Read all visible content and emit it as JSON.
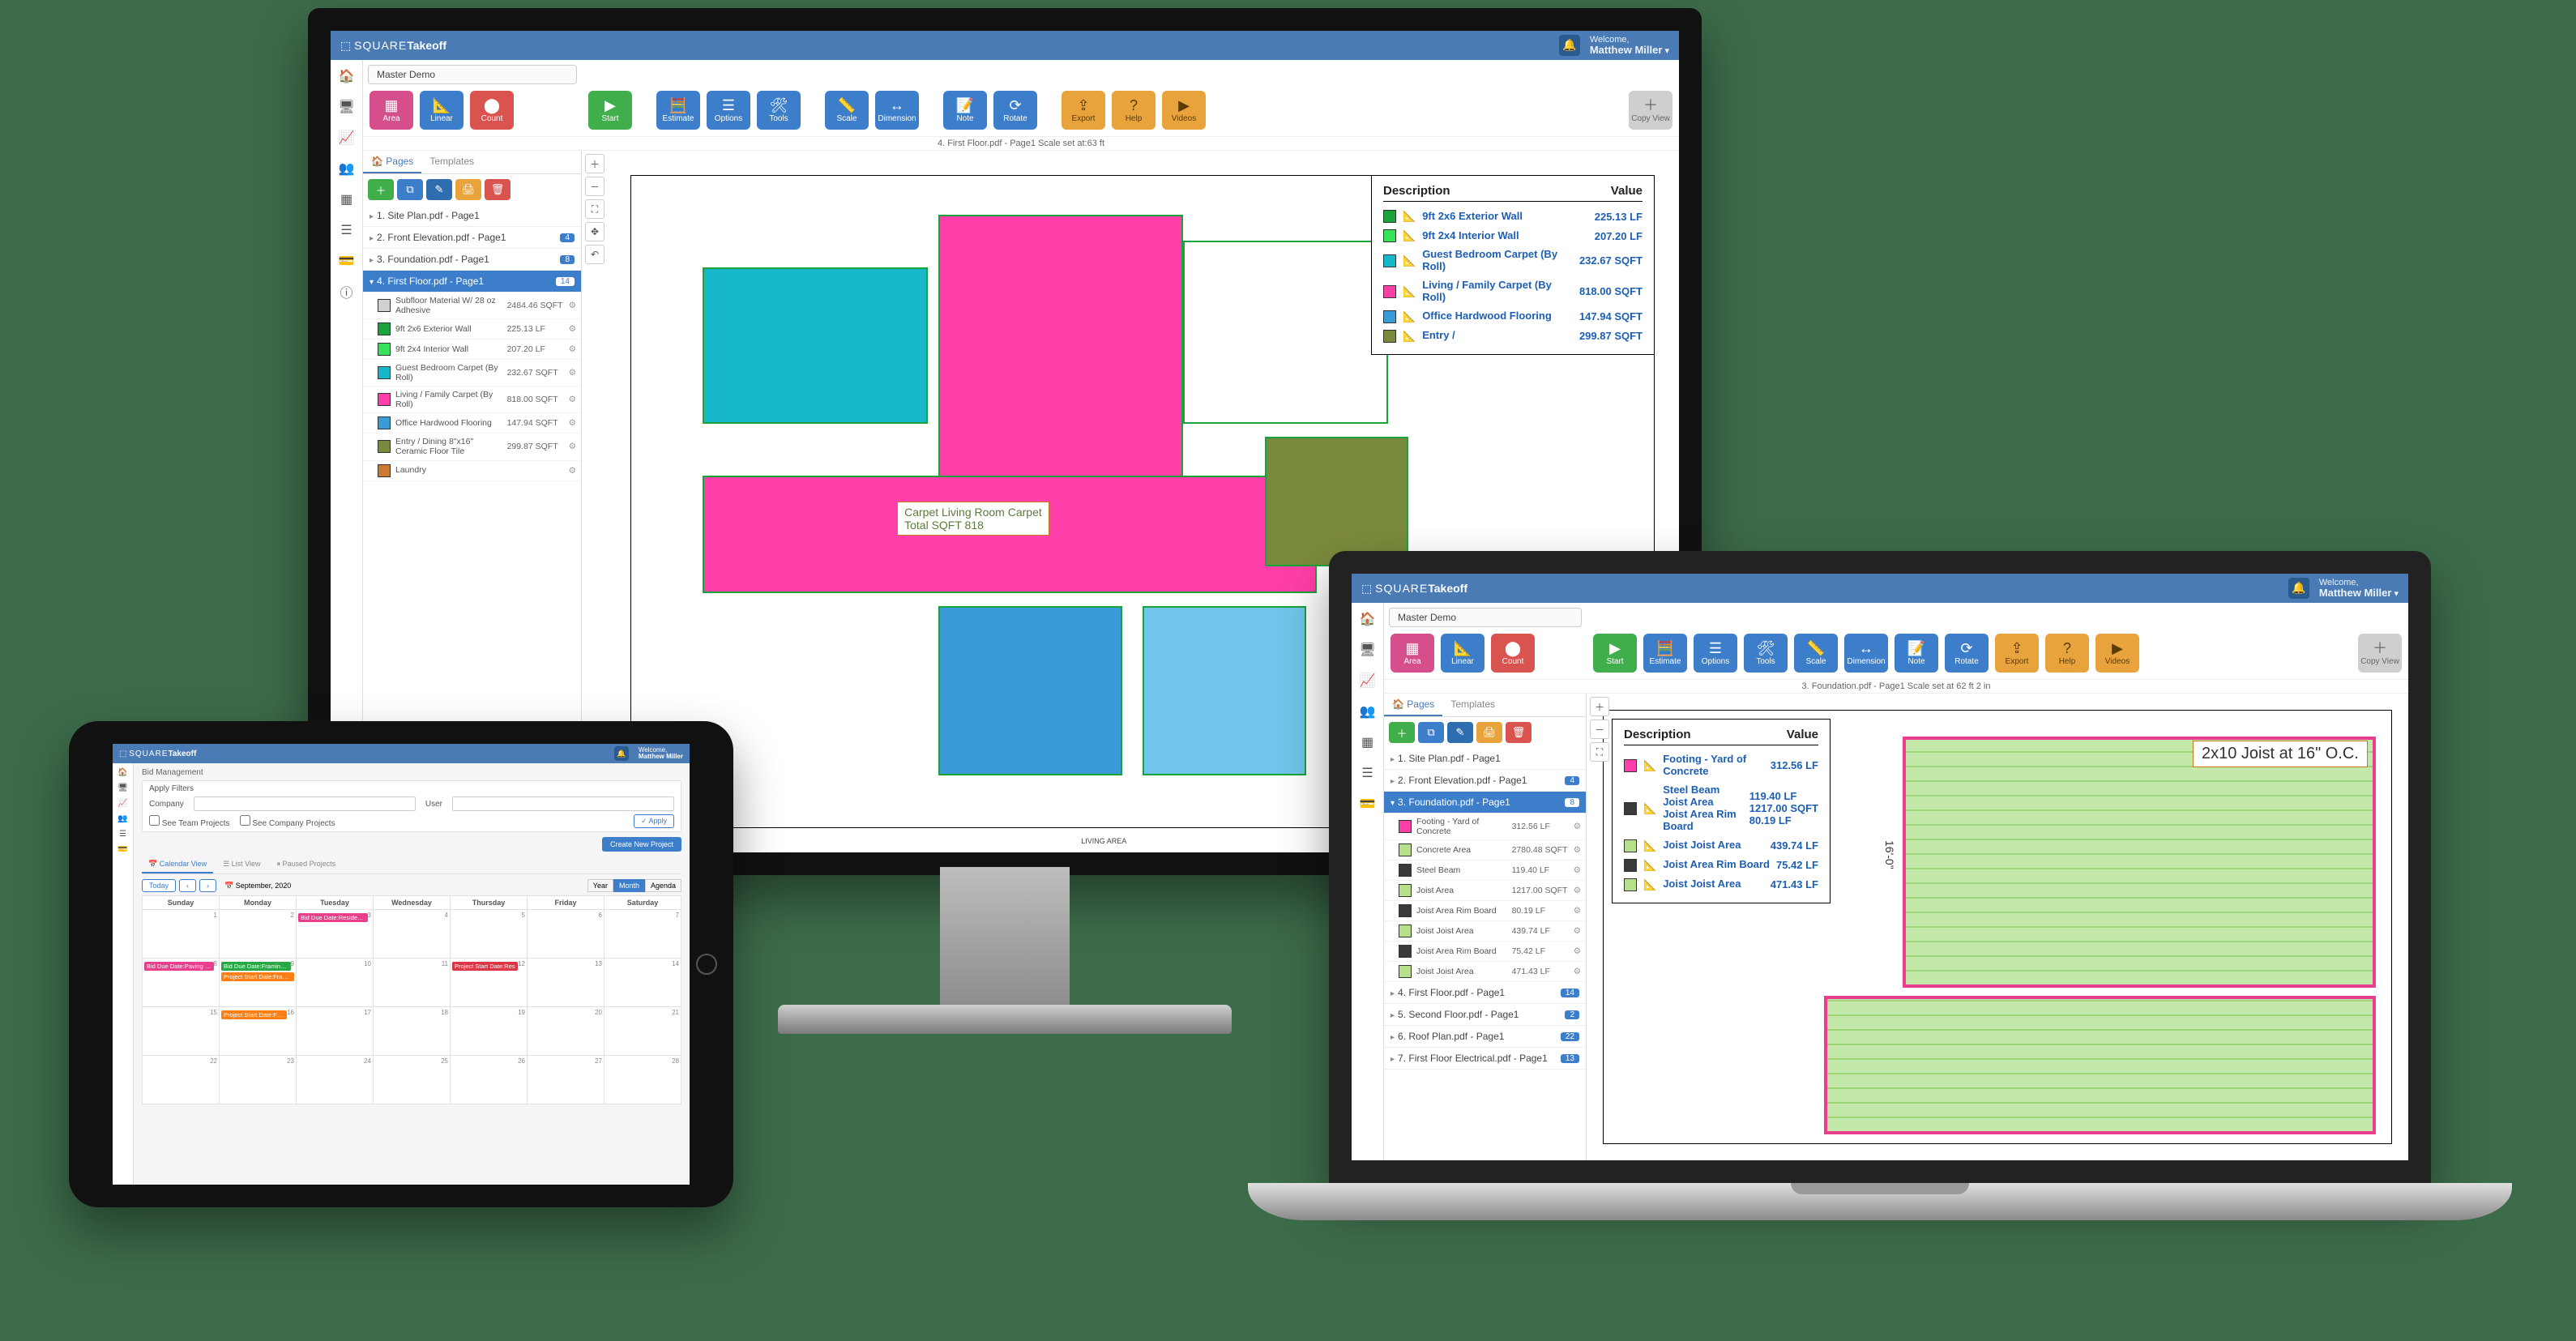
{
  "brand": {
    "part1": "SQUARE",
    "part2": "Takeoff"
  },
  "user": {
    "welcome": "Welcome,",
    "name": "Matthew Miller"
  },
  "ribbon": {
    "area": "Area",
    "linear": "Linear",
    "count": "Count",
    "start": "Start",
    "estimate": "Estimate",
    "options": "Options",
    "tools": "Tools",
    "scale": "Scale",
    "dimension": "Dimension",
    "note": "Note",
    "rotate": "Rotate",
    "export": "Export",
    "help": "Help",
    "videos": "Videos",
    "copy": "Copy View"
  },
  "monitor": {
    "project": "Master Demo",
    "breadcrumb": "4. First Floor.pdf - Page1 Scale set at:63 ft",
    "tabs": {
      "pages": "Pages",
      "templates": "Templates"
    },
    "pages": [
      {
        "name": "1. Site Plan.pdf - Page1"
      },
      {
        "name": "2. Front Elevation.pdf - Page1",
        "count": "4"
      },
      {
        "name": "3. Foundation.pdf - Page1",
        "count": "8"
      },
      {
        "name": "4. First Floor.pdf - Page1",
        "count": "14",
        "active": true
      }
    ],
    "measurements": [
      {
        "color": "#d1d1d1",
        "desc": "Subfloor Material W/ 28 oz Adhesive",
        "val": "2484.46 SQFT"
      },
      {
        "color": "#1aa33a",
        "desc": "9ft 2x6 Exterior Wall",
        "val": "225.13 LF"
      },
      {
        "color": "#34e35a",
        "desc": "9ft 2x4 Interior Wall",
        "val": "207.20 LF"
      },
      {
        "color": "#16b7c9",
        "desc": "Guest Bedroom Carpet (By Roll)",
        "val": "232.67 SQFT"
      },
      {
        "color": "#ff3fa9",
        "desc": "Living / Family Carpet (By Roll)",
        "val": "818.00 SQFT"
      },
      {
        "color": "#3a9bd8",
        "desc": "Office Hardwood Flooring",
        "val": "147.94 SQFT"
      },
      {
        "color": "#7a8a3d",
        "desc": "Entry / Dining 8\"x16\" Ceramic Floor Tile",
        "val": "299.87 SQFT"
      },
      {
        "color": "#cc7a33",
        "desc": "Laundry",
        "val": ""
      }
    ],
    "floor_label_line1": "Carpet Living Room Carpet",
    "floor_label_line2": "Total SQFT 818",
    "floor_living_area": "LIVING AREA",
    "legend": {
      "hdr_desc": "Description",
      "hdr_val": "Value",
      "rows": [
        {
          "color": "#1aa33a",
          "desc": "9ft 2x6 Exterior Wall",
          "val": "225.13 LF"
        },
        {
          "color": "#34e35a",
          "desc": "9ft 2x4 Interior Wall",
          "val": "207.20 LF"
        },
        {
          "color": "#16b7c9",
          "desc": "Guest Bedroom Carpet (By Roll)",
          "val": "232.67 SQFT"
        },
        {
          "color": "#ff3fa9",
          "desc": "Living / Family Carpet (By Roll)",
          "val": "818.00 SQFT"
        },
        {
          "color": "#3a9bd8",
          "desc": "Office Hardwood Flooring",
          "val": "147.94 SQFT"
        },
        {
          "color": "#7a8a3d",
          "desc": "Entry /",
          "val": "299.87 SQFT"
        }
      ]
    }
  },
  "laptop": {
    "project": "Master Demo",
    "breadcrumb": "3. Foundation.pdf - Page1 Scale set at 62 ft 2 in",
    "pages": [
      {
        "name": "1. Site Plan.pdf - Page1"
      },
      {
        "name": "2. Front Elevation.pdf - Page1",
        "count": "4"
      },
      {
        "name": "3. Foundation.pdf - Page1",
        "count": "8",
        "active": true
      },
      {
        "name": "4. First Floor.pdf - Page1",
        "count": "14"
      },
      {
        "name": "5. Second Floor.pdf - Page1",
        "count": "2"
      },
      {
        "name": "6. Roof Plan.pdf - Page1",
        "count": "22"
      },
      {
        "name": "7. First Floor Electrical.pdf - Page1",
        "count": "13"
      }
    ],
    "measurements": [
      {
        "color": "#ff3fa9",
        "desc": "Footing - Yard of Concrete",
        "val": "312.56 LF"
      },
      {
        "color": "#b7e08a",
        "desc": "Concrete Area",
        "val": "2780.48 SQFT"
      },
      {
        "color": "#3a3a3a",
        "desc": "Steel Beam",
        "val": "119.40 LF"
      },
      {
        "color": "#b7e08a",
        "desc": "Joist Area",
        "val": "1217.00 SQFT"
      },
      {
        "color": "#3a3a3a",
        "desc": "Joist Area Rim Board",
        "val": "80.19 LF"
      },
      {
        "color": "#b7e08a",
        "desc": "Joist Joist Area",
        "val": "439.74 LF"
      },
      {
        "color": "#3a3a3a",
        "desc": "Joist Area Rim Board",
        "val": "75.42 LF"
      },
      {
        "color": "#b7e08a",
        "desc": "Joist Joist Area",
        "val": "471.43 LF"
      }
    ],
    "joist_label": "2x10 Joist at 16\" O.C.",
    "dim_v": "16'-0\"",
    "legend": {
      "rows": [
        {
          "color": "#ff3fa9",
          "desc": "Footing - Yard of Concrete",
          "val": "312.56 LF"
        },
        {
          "color": "#3a3a3a",
          "desc": "Steel Beam\nJoist Area\nJoist Area Rim Board",
          "val": "119.40 LF\n1217.00 SQFT\n80.19 LF"
        },
        {
          "color": "#b7e08a",
          "desc": "Joist Joist Area",
          "val": "439.74 LF"
        },
        {
          "color": "#3a3a3a",
          "desc": "Joist Area Rim Board",
          "val": "75.42 LF"
        },
        {
          "color": "#b7e08a",
          "desc": "Joist Joist Area",
          "val": "471.43 LF"
        }
      ]
    }
  },
  "tablet": {
    "crumb": "Bid Management",
    "apply_filters": "Apply Filters",
    "lbl_company": "Company",
    "lbl_user": "User",
    "see_team": "See Team Projects",
    "see_company": "See Company Projects",
    "btn_apply": "✓ Apply",
    "btn_create": "Create New Project",
    "views": {
      "calendar": "Calendar View",
      "list": "List View",
      "paused": "Paused Projects"
    },
    "cal": {
      "today": "Today",
      "month_label": "September, 2020",
      "segments": [
        "Year",
        "Month",
        "Agenda"
      ],
      "days": [
        "Sunday",
        "Monday",
        "Tuesday",
        "Wednesday",
        "Thursday",
        "Friday",
        "Saturday"
      ],
      "events": {
        "r1c3": [
          {
            "cls": "pink",
            "t": "Bid Due Date:Residential Project"
          }
        ],
        "r2c1": [
          {
            "cls": "pink",
            "t": "Bid Due Date:Paving Project"
          }
        ],
        "r2c2": [
          {
            "cls": "green",
            "t": "Bid Due Date:Framing Estimate"
          },
          {
            "cls": "orange",
            "t": "Project Start Date:Framing"
          }
        ],
        "r2c5": [
          {
            "cls": "red",
            "t": "Project Start Date:Res"
          }
        ],
        "r3c2": [
          {
            "cls": "orange",
            "t": "Project Start Date:Framing"
          }
        ]
      }
    }
  }
}
